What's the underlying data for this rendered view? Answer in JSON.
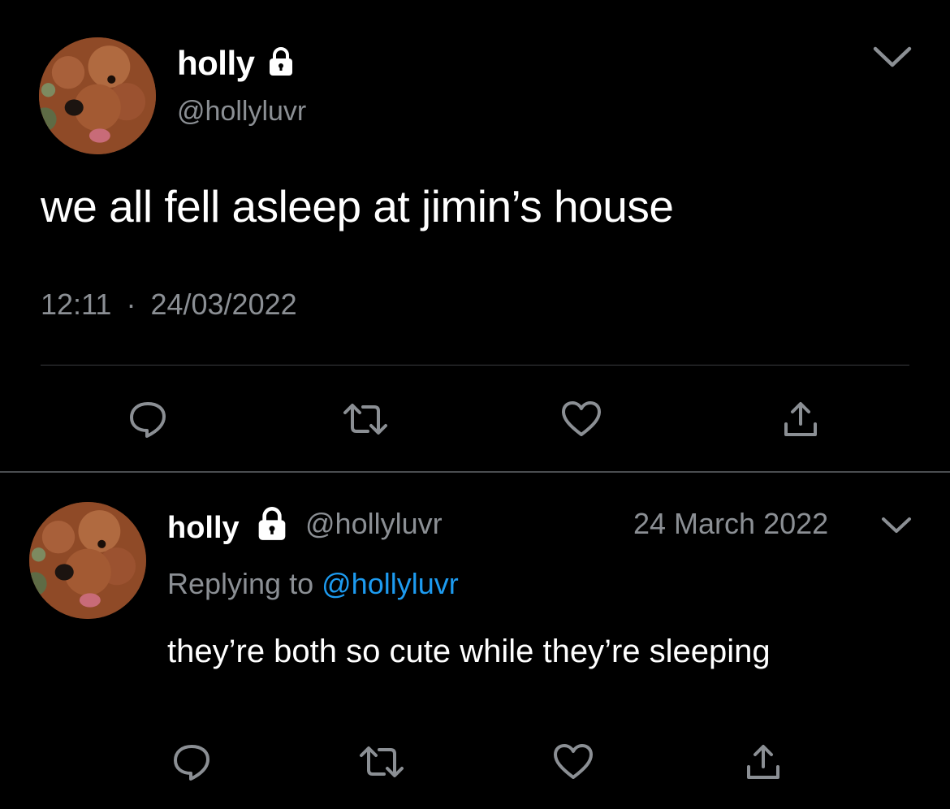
{
  "main_tweet": {
    "display_name": "holly",
    "handle": "@hollyluvr",
    "text": "we all fell asleep at jimin’s house",
    "time": "12:11",
    "separator": "·",
    "date": "24/03/2022",
    "icons": {
      "lock": "lock-icon",
      "more": "chevron-down-icon",
      "reply": "reply-icon",
      "retweet": "retweet-icon",
      "like": "heart-icon",
      "share": "share-icon"
    }
  },
  "reply_tweet": {
    "display_name": "holly",
    "handle": "@hollyluvr",
    "date": "24 March 2022",
    "replying_prefix": "Replying to",
    "replying_to": "@hollyluvr",
    "text": "they’re both so cute while they’re sleeping"
  },
  "colors": {
    "background": "#000000",
    "text_primary": "#ffffff",
    "text_secondary": "#8b8f94",
    "mention": "#1d9bf0",
    "divider": "#3a3d40"
  }
}
